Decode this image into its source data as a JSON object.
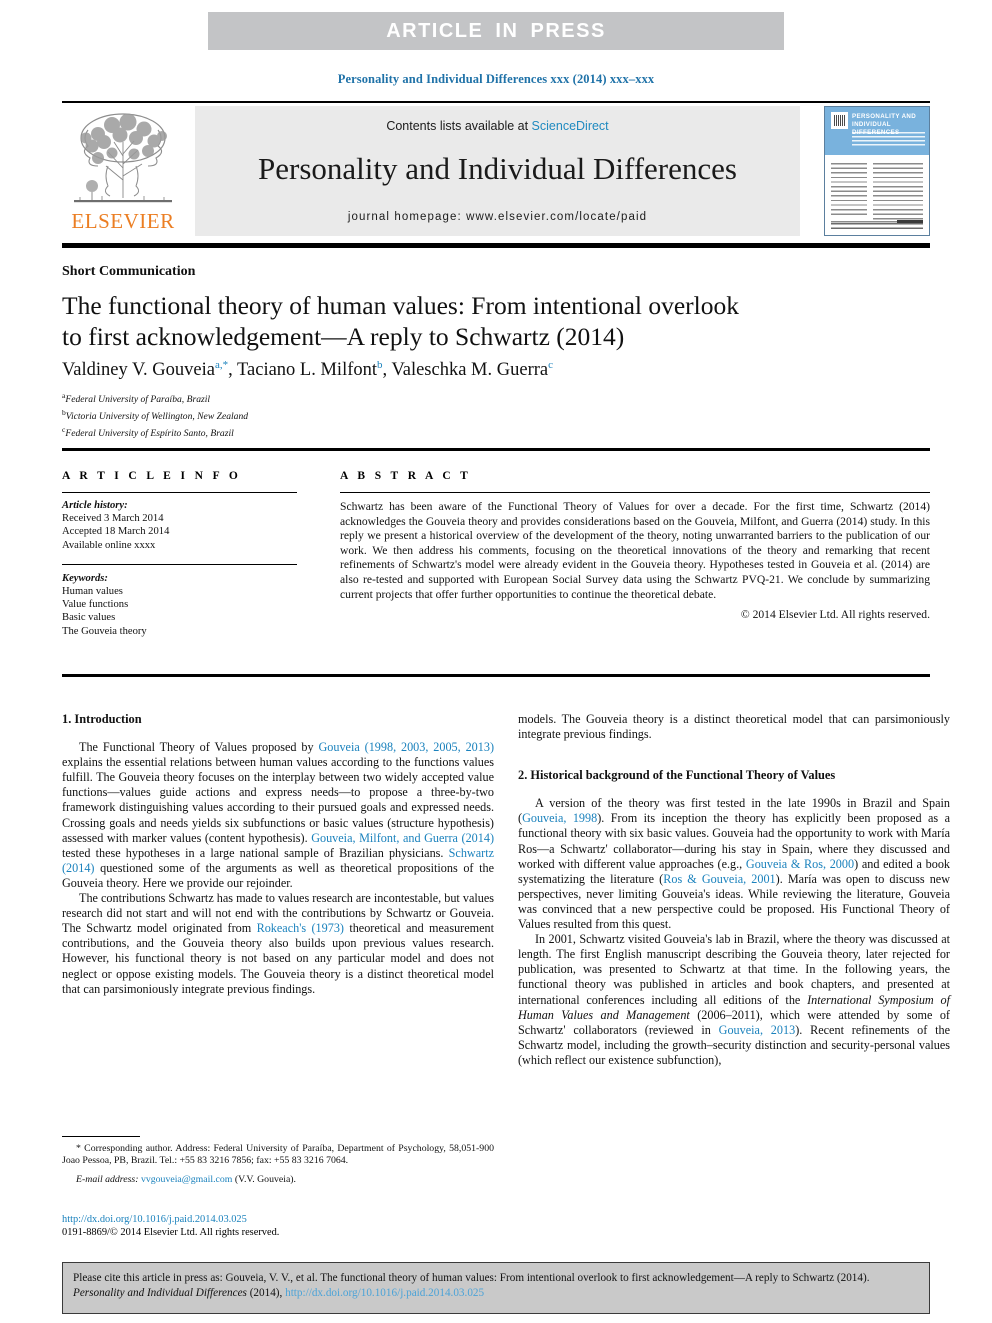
{
  "banner": {
    "label": "ARTICLE  IN  PRESS"
  },
  "running_head": "Personality and Individual Differences xxx (2014) xxx–xxx",
  "masthead": {
    "contents_prefix": "Contents lists available at ",
    "sciencedirect": "ScienceDirect",
    "journal_title": "Personality and Individual Differences",
    "homepage": "journal homepage: www.elsevier.com/locate/paid",
    "publisher": "ELSEVIER",
    "cover": {
      "title_line1": "PERSONALITY AND",
      "title_line2": "INDIVIDUAL DIFFERENCES"
    }
  },
  "article": {
    "kicker": "Short Communication",
    "title_line1": "The functional theory of human values: From intentional overlook",
    "title_line2": "to first acknowledgement—A reply to Schwartz (2014)",
    "authors": [
      {
        "name": "Valdiney V. Gouveia",
        "marks": "a,*"
      },
      {
        "name": "Taciano L. Milfont",
        "marks": "b"
      },
      {
        "name": "Valeschka M. Guerra",
        "marks": "c"
      }
    ],
    "affiliations": [
      {
        "mark": "a",
        "text": "Federal University of Paraíba, Brazil"
      },
      {
        "mark": "b",
        "text": "Victoria University of Wellington, New Zealand"
      },
      {
        "mark": "c",
        "text": "Federal University of Espírito Santo, Brazil"
      }
    ]
  },
  "article_info": {
    "heading": "A R T I C L E  I N F O",
    "history_label": "Article history:",
    "history": [
      "Received 3 March 2014",
      "Accepted 18 March 2014",
      "Available online xxxx"
    ],
    "keywords_label": "Keywords:",
    "keywords": [
      "Human values",
      "Value functions",
      "Basic values",
      "The Gouveia theory"
    ]
  },
  "abstract": {
    "heading": "A B S T R A C T",
    "text": "Schwartz has been aware of the Functional Theory of Values for over a decade. For the first time, Schwartz (2014) acknowledges the Gouveia theory and provides considerations based on the Gouveia, Milfont, and Guerra (2014) study. In this reply we present a historical overview of the development of the theory, noting unwarranted barriers to the publication of our work. We then address his comments, focusing on the theoretical innovations of the theory and remarking that recent refinements of Schwartz's model were already evident in the Gouveia theory. Hypotheses tested in Gouveia et al. (2014) are also re-tested and supported with European Social Survey data using the Schwartz PVQ-21. We conclude by summarizing current projects that offer further opportunities to continue the theoretical debate.",
    "copyright": "© 2014 Elsevier Ltd. All rights reserved."
  },
  "body": {
    "section1_heading": "1. Introduction",
    "section1_p1_a": "The Functional Theory of Values proposed by ",
    "section1_p1_ref1": "Gouveia (1998, 2003, 2005, 2013)",
    "section1_p1_b": " explains the essential relations between human values according to the functions values fulfill. The Gouveia theory focuses on the interplay between two widely accepted value functions—values guide actions and express needs—to propose a three-by-two framework distinguishing values according to their pursued goals and expressed needs. Crossing goals and needs yields six subfunctions or basic values (structure hypothesis) assessed with marker values (content hypothesis). ",
    "section1_p1_ref2": "Gouveia, Milfont, and Guerra (2014)",
    "section1_p1_c": " tested these hypotheses in a large national sample of Brazilian physicians. ",
    "section1_p1_ref3": "Schwartz (2014)",
    "section1_p1_d": " questioned some of the arguments as well as theoretical propositions of the Gouveia theory. Here we provide our rejoinder.",
    "section1_p2_a": "The contributions Schwartz has made to values research are incontestable, but values research did not start and will not end with the contributions by Schwartz or Gouveia. The Schwartz model originated from ",
    "section1_p2_ref1": "Rokeach's (1973)",
    "section1_p2_b": " theoretical and measurement contributions, and the Gouveia theory also builds upon previous values research. However, his functional theory is not based on any particular model and does not neglect or oppose existing models. The Gouveia theory is a distinct theoretical model that can parsimoniously integrate previous findings.",
    "section2_heading": "2. Historical background of the Functional Theory of Values",
    "section2_p1_a": "A version of the theory was first tested in the late 1990s in Brazil and Spain (",
    "section2_p1_ref1": "Gouveia, 1998",
    "section2_p1_b": "). From its inception the theory has explicitly been proposed as a functional theory with six basic values. Gouveia had the opportunity to work with María Ros—a Schwartz' collaborator—during his stay in Spain, where they discussed and worked with different value approaches (e.g., ",
    "section2_p1_ref2": "Gouveia & Ros, 2000",
    "section2_p1_c": ") and edited a book systematizing the literature (",
    "section2_p1_ref3": "Ros & Gouveia, 2001",
    "section2_p1_d": "). María was open to discuss new perspectives, never limiting Gouveia's ideas. While reviewing the literature, Gouveia was convinced that a new perspective could be proposed. His Functional Theory of Values resulted from this quest.",
    "section2_p2_a": "In 2001, Schwartz visited Gouveia's lab in Brazil, where the theory was discussed at length. The first English manuscript describing the Gouveia theory, later rejected for publication, was presented to Schwartz at that time. In the following years, the functional theory was published in articles and book chapters, and presented at international conferences including all editions of the ",
    "section2_p2_ital": "International Symposium of Human Values and Management",
    "section2_p2_b": " (2006–2011), which were attended by some of Schwartz' collaborators (reviewed in ",
    "section2_p2_ref1": "Gouveia, 2013",
    "section2_p2_c": "). Recent refinements of the Schwartz model, including the growth–security distinction and security-personal values (which reflect our existence subfunction),"
  },
  "footnote": {
    "corresponding": "* Corresponding author. Address: Federal University of Paraíba, Department of Psychology, 58,051-900 Joao Pessoa, PB, Brazil. Tel.: +55 83 3216 7856; fax: +55 83 3216 7064.",
    "email_label": "E-mail address:",
    "email": "vvgouveia@gmail.com",
    "email_suffix": " (V.V. Gouveia).",
    "doi": "http://dx.doi.org/10.1016/j.paid.2014.03.025",
    "issn_line": "0191-8869/© 2014 Elsevier Ltd. All rights reserved."
  },
  "cite_box": {
    "prefix": "Please cite this article in press as: Gouveia, V. V., et al. The functional theory of human values: From intentional overlook to first acknowledgement—A reply to Schwartz (2014). ",
    "journal": "Personality and Individual Differences",
    "middle": " (2014), ",
    "doi": "http://dx.doi.org/10.1016/j.paid.2014.03.025"
  },
  "colors": {
    "link": "#1b82bd",
    "banner_bg": "#c3c4c6",
    "masthead_bg": "#eaeaea",
    "elsevier_orange": "#eb7e23",
    "cite_box_bg": "#c9c9c9"
  }
}
